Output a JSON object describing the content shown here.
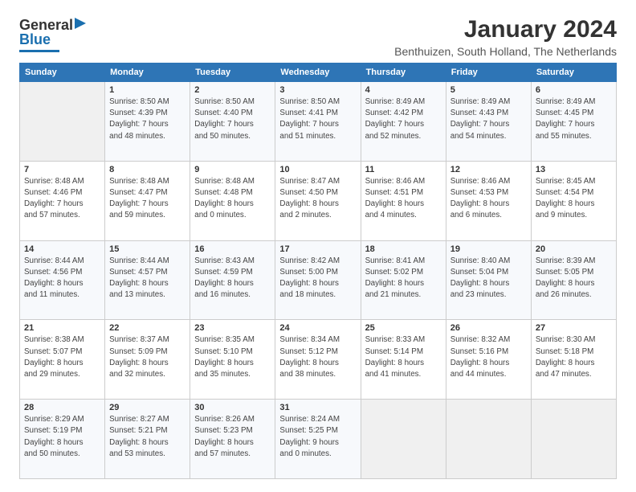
{
  "logo": {
    "line1": "General",
    "line2": "Blue"
  },
  "title": "January 2024",
  "subtitle": "Benthuizen, South Holland, The Netherlands",
  "days_header": [
    "Sunday",
    "Monday",
    "Tuesday",
    "Wednesday",
    "Thursday",
    "Friday",
    "Saturday"
  ],
  "weeks": [
    [
      {
        "day": "",
        "info": ""
      },
      {
        "day": "1",
        "info": "Sunrise: 8:50 AM\nSunset: 4:39 PM\nDaylight: 7 hours\nand 48 minutes."
      },
      {
        "day": "2",
        "info": "Sunrise: 8:50 AM\nSunset: 4:40 PM\nDaylight: 7 hours\nand 50 minutes."
      },
      {
        "day": "3",
        "info": "Sunrise: 8:50 AM\nSunset: 4:41 PM\nDaylight: 7 hours\nand 51 minutes."
      },
      {
        "day": "4",
        "info": "Sunrise: 8:49 AM\nSunset: 4:42 PM\nDaylight: 7 hours\nand 52 minutes."
      },
      {
        "day": "5",
        "info": "Sunrise: 8:49 AM\nSunset: 4:43 PM\nDaylight: 7 hours\nand 54 minutes."
      },
      {
        "day": "6",
        "info": "Sunrise: 8:49 AM\nSunset: 4:45 PM\nDaylight: 7 hours\nand 55 minutes."
      }
    ],
    [
      {
        "day": "7",
        "info": "Sunrise: 8:48 AM\nSunset: 4:46 PM\nDaylight: 7 hours\nand 57 minutes."
      },
      {
        "day": "8",
        "info": "Sunrise: 8:48 AM\nSunset: 4:47 PM\nDaylight: 7 hours\nand 59 minutes."
      },
      {
        "day": "9",
        "info": "Sunrise: 8:48 AM\nSunset: 4:48 PM\nDaylight: 8 hours\nand 0 minutes."
      },
      {
        "day": "10",
        "info": "Sunrise: 8:47 AM\nSunset: 4:50 PM\nDaylight: 8 hours\nand 2 minutes."
      },
      {
        "day": "11",
        "info": "Sunrise: 8:46 AM\nSunset: 4:51 PM\nDaylight: 8 hours\nand 4 minutes."
      },
      {
        "day": "12",
        "info": "Sunrise: 8:46 AM\nSunset: 4:53 PM\nDaylight: 8 hours\nand 6 minutes."
      },
      {
        "day": "13",
        "info": "Sunrise: 8:45 AM\nSunset: 4:54 PM\nDaylight: 8 hours\nand 9 minutes."
      }
    ],
    [
      {
        "day": "14",
        "info": "Sunrise: 8:44 AM\nSunset: 4:56 PM\nDaylight: 8 hours\nand 11 minutes."
      },
      {
        "day": "15",
        "info": "Sunrise: 8:44 AM\nSunset: 4:57 PM\nDaylight: 8 hours\nand 13 minutes."
      },
      {
        "day": "16",
        "info": "Sunrise: 8:43 AM\nSunset: 4:59 PM\nDaylight: 8 hours\nand 16 minutes."
      },
      {
        "day": "17",
        "info": "Sunrise: 8:42 AM\nSunset: 5:00 PM\nDaylight: 8 hours\nand 18 minutes."
      },
      {
        "day": "18",
        "info": "Sunrise: 8:41 AM\nSunset: 5:02 PM\nDaylight: 8 hours\nand 21 minutes."
      },
      {
        "day": "19",
        "info": "Sunrise: 8:40 AM\nSunset: 5:04 PM\nDaylight: 8 hours\nand 23 minutes."
      },
      {
        "day": "20",
        "info": "Sunrise: 8:39 AM\nSunset: 5:05 PM\nDaylight: 8 hours\nand 26 minutes."
      }
    ],
    [
      {
        "day": "21",
        "info": "Sunrise: 8:38 AM\nSunset: 5:07 PM\nDaylight: 8 hours\nand 29 minutes."
      },
      {
        "day": "22",
        "info": "Sunrise: 8:37 AM\nSunset: 5:09 PM\nDaylight: 8 hours\nand 32 minutes."
      },
      {
        "day": "23",
        "info": "Sunrise: 8:35 AM\nSunset: 5:10 PM\nDaylight: 8 hours\nand 35 minutes."
      },
      {
        "day": "24",
        "info": "Sunrise: 8:34 AM\nSunset: 5:12 PM\nDaylight: 8 hours\nand 38 minutes."
      },
      {
        "day": "25",
        "info": "Sunrise: 8:33 AM\nSunset: 5:14 PM\nDaylight: 8 hours\nand 41 minutes."
      },
      {
        "day": "26",
        "info": "Sunrise: 8:32 AM\nSunset: 5:16 PM\nDaylight: 8 hours\nand 44 minutes."
      },
      {
        "day": "27",
        "info": "Sunrise: 8:30 AM\nSunset: 5:18 PM\nDaylight: 8 hours\nand 47 minutes."
      }
    ],
    [
      {
        "day": "28",
        "info": "Sunrise: 8:29 AM\nSunset: 5:19 PM\nDaylight: 8 hours\nand 50 minutes."
      },
      {
        "day": "29",
        "info": "Sunrise: 8:27 AM\nSunset: 5:21 PM\nDaylight: 8 hours\nand 53 minutes."
      },
      {
        "day": "30",
        "info": "Sunrise: 8:26 AM\nSunset: 5:23 PM\nDaylight: 8 hours\nand 57 minutes."
      },
      {
        "day": "31",
        "info": "Sunrise: 8:24 AM\nSunset: 5:25 PM\nDaylight: 9 hours\nand 0 minutes."
      },
      {
        "day": "",
        "info": ""
      },
      {
        "day": "",
        "info": ""
      },
      {
        "day": "",
        "info": ""
      }
    ]
  ]
}
